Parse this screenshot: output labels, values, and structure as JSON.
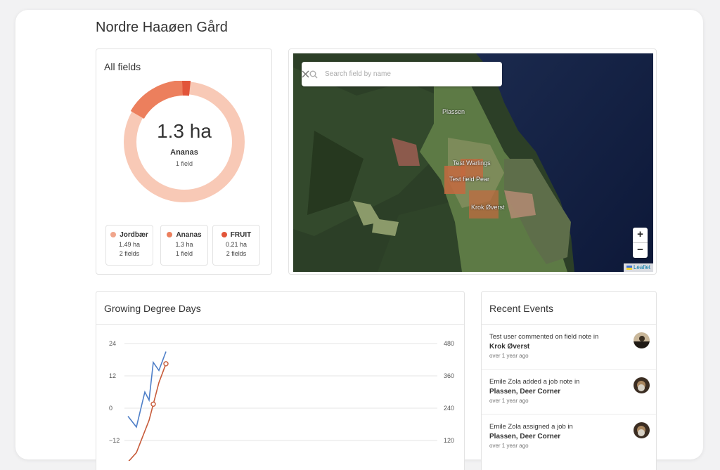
{
  "page": {
    "title": "Nordre Haaøen Gård"
  },
  "all_fields": {
    "title": "All fields",
    "selected": {
      "value": "1.3 ha",
      "name": "Ananas",
      "count": "1 field"
    },
    "legend": [
      {
        "name": "Jordbær",
        "area": "1.49 ha",
        "count": "2 fields",
        "color": "#f0a58b"
      },
      {
        "name": "Ananas",
        "area": "1.3 ha",
        "count": "1 field",
        "color": "#ec7f5d"
      },
      {
        "name": "FRUIT",
        "area": "0.21 ha",
        "count": "2 fields",
        "color": "#e2553a"
      }
    ],
    "ring_colors": {
      "track": "#f8c9b6",
      "jordbaer": "#f3b49c",
      "ananas": "#ec7f5d",
      "fruit": "#e2553a"
    }
  },
  "map": {
    "search": {
      "placeholder": "Search field by name"
    },
    "labels": [
      "Plassen",
      "Test Warlings",
      "Test field Pear",
      "Krok Øverst"
    ],
    "zoom_in": "+",
    "zoom_out": "−",
    "attribution": "Leaflet"
  },
  "gdd": {
    "title": "Growing Degree Days",
    "left_ticks": [
      "24",
      "12",
      "0",
      "−12"
    ],
    "right_ticks": [
      "480",
      "360",
      "240",
      "120"
    ]
  },
  "chart_data": {
    "type": "line",
    "title": "Growing Degree Days",
    "y_left": {
      "ticks": [
        24,
        12,
        0,
        -12
      ],
      "range": [
        -20,
        24
      ]
    },
    "y_right": {
      "ticks": [
        480,
        360,
        240,
        120
      ],
      "range": [
        40,
        480
      ]
    },
    "series": [
      {
        "axis": "left",
        "color": "#4f7fc8",
        "values": [
          -3,
          -7,
          6,
          3,
          17,
          14,
          21
        ]
      },
      {
        "axis": "right",
        "color": "#c75b3a",
        "values": [
          40,
          75,
          155,
          195,
          255,
          335,
          405
        ]
      }
    ]
  },
  "events": {
    "title": "Recent Events",
    "items": [
      {
        "text": "Test user commented on field note in",
        "field": "Krok Øverst",
        "time": "over 1 year ago"
      },
      {
        "text": "Emile Zola added a job note in",
        "field": "Plassen, Deer Corner",
        "time": "over 1 year ago"
      },
      {
        "text": "Emile Zola assigned a job in",
        "field": "Plassen, Deer Corner",
        "time": "over 1 year ago"
      }
    ]
  }
}
